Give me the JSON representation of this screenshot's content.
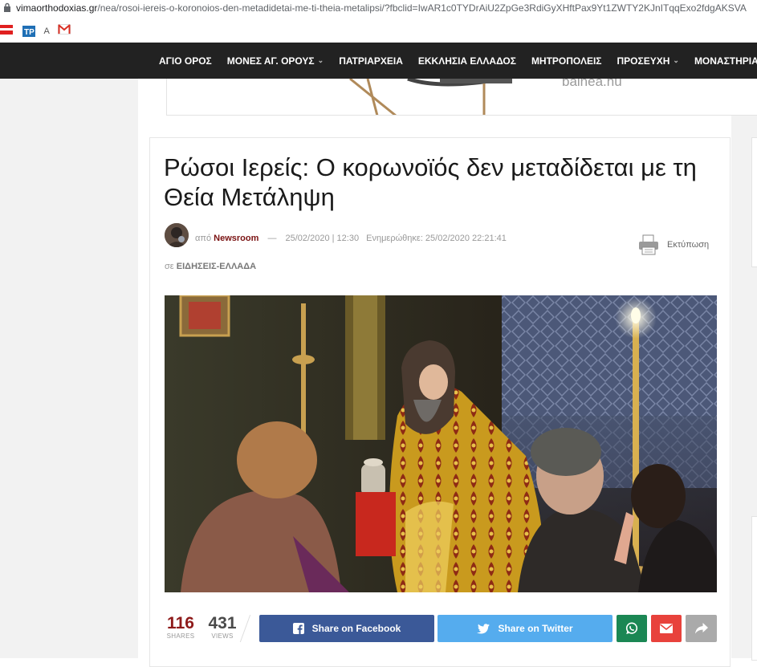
{
  "browser": {
    "url_host": "vimaorthodoxias.gr",
    "url_path": "/nea/rosoi-iereis-o-koronoios-den-metadidetai-me-ti-theia-metalipsi/?fbclid=IwAR1c0TYDrAiU2ZpGe3RdiGyXHftPax9Yt1ZWTY2KJnITqqExo2fdgAKSVA",
    "bookmarks": [
      {
        "icon": "red-flag-icon",
        "label": ""
      },
      {
        "icon": "tp-icon",
        "label": "A"
      },
      {
        "icon": "gmail-icon",
        "label": ""
      }
    ]
  },
  "nav": {
    "items": [
      {
        "label": "ΑΓΙΟ ΟΡΟΣ",
        "dropdown": false
      },
      {
        "label": "ΜΟΝΕΣ ΑΓ. ΟΡΟΥΣ",
        "dropdown": true
      },
      {
        "label": "ΠΑΤΡΙΑΡΧΕΙΑ",
        "dropdown": false
      },
      {
        "label": "ΕΚΚΛΗΣΙΑ ΕΛΛΑΔΟΣ",
        "dropdown": false
      },
      {
        "label": "ΜΗΤΡΟΠΟΛΕΙΣ",
        "dropdown": false
      },
      {
        "label": "ΠΡΟΣΕΥΧΗ",
        "dropdown": true
      },
      {
        "label": "ΜΟΝΑΣΤΗΡΙΑ ΤΟ",
        "dropdown": false
      }
    ]
  },
  "ad": {
    "text": "bainea.hu"
  },
  "article": {
    "title": "Ρώσοι Ιερείς: Ο κορωνοϊός δεν μεταδίδεται με τη Θεία Μετάληψη",
    "by_prefix": "από",
    "author": "Newsroom",
    "date": "25/02/2020 | 12:30",
    "updated": "Ενημερώθηκε: 25/02/2020 22:21:41",
    "print_label": "Εκτύπωση",
    "category_prefix": "σε",
    "category": "ΕΙΔΗΣΕΙΣ-ΕΛΛΑΔΑ"
  },
  "share": {
    "shares_count": "116",
    "shares_label": "SHARES",
    "views_count": "431",
    "views_label": "VIEWS",
    "facebook_label": "Share on Facebook",
    "twitter_label": "Share on Twitter"
  },
  "colors": {
    "nav_bg": "#222222",
    "author": "#7a1212",
    "facebook": "#3b5998",
    "twitter": "#55acee",
    "whatsapp": "#1b8754",
    "email": "#e8423c",
    "more": "#aaaaaa"
  }
}
